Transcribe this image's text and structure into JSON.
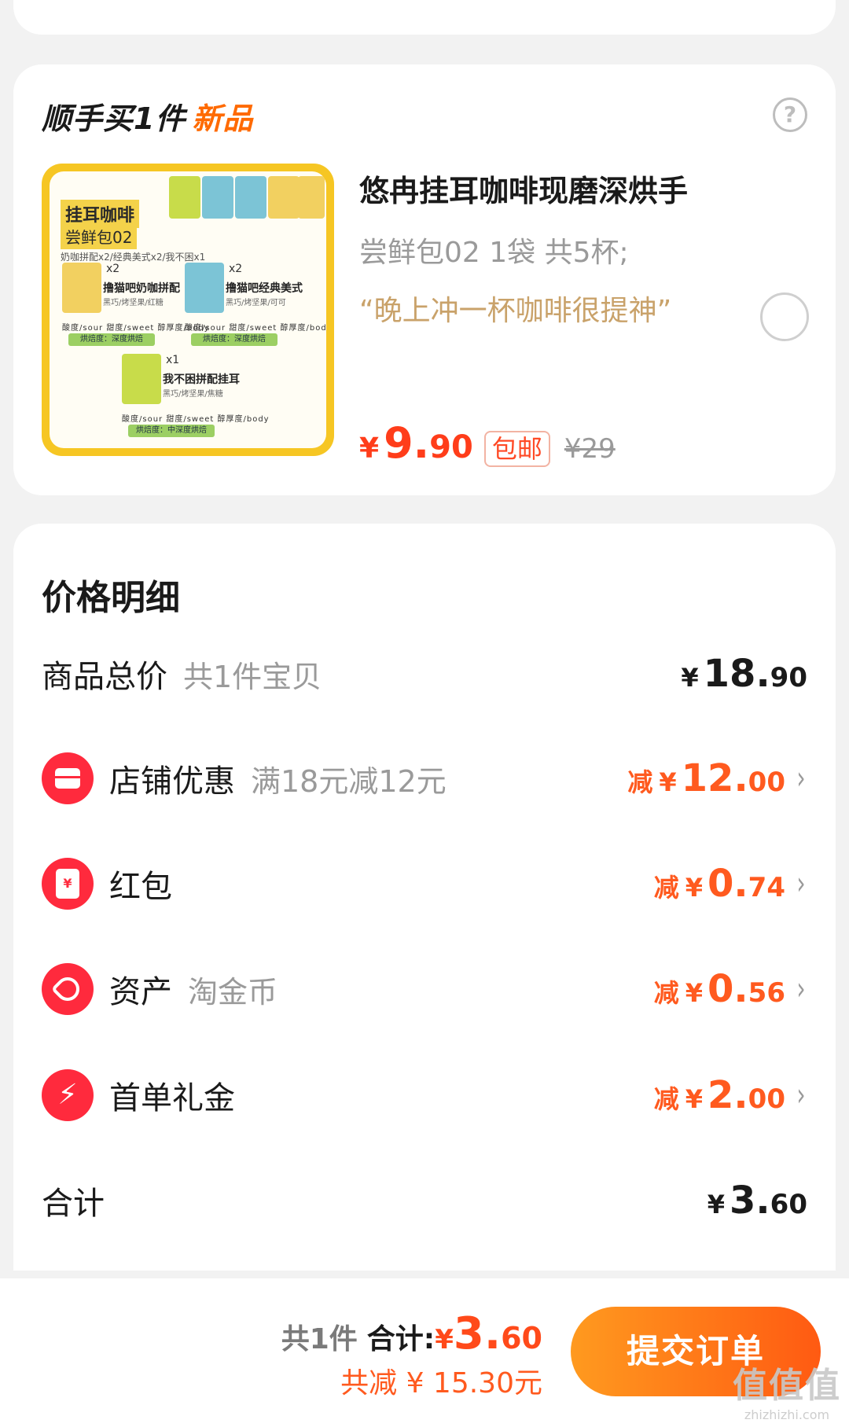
{
  "addon": {
    "title": "顺手买1件",
    "title_tag": "新品",
    "help": "?",
    "thumbnail": {
      "title": "挂耳咖啡",
      "subtitle": "尝鲜包02",
      "line": "奶咖拼配x2/经典美式x2/我不困x1",
      "packs": [
        {
          "qty": "x2",
          "name": "撸猫吧奶咖拼配",
          "notes": "黑巧/烤坚果/红糖",
          "dots": "酸度/sour 甜度/sweet 醇厚度/body",
          "roast": "烘焙度：深度烘焙"
        },
        {
          "qty": "x2",
          "name": "撸猫吧经典美式",
          "notes": "黑巧/烤坚果/可可",
          "dots": "酸度/sour 甜度/sweet 醇厚度/body",
          "roast": "烘焙度：深度烘焙"
        },
        {
          "qty": "x1",
          "name": "我不困拼配挂耳",
          "notes": "黑巧/烤坚果/焦糖",
          "dots": "酸度/sour 甜度/sweet 醇厚度/body",
          "roast": "烘焙度：中深度烘焙"
        }
      ]
    },
    "product_title": "悠冉挂耳咖啡现磨深烘手",
    "spec": "尝鲜包02 1袋 共5杯;",
    "quote": "“晚上冲一杯咖啡很提神”",
    "price_yen": "¥",
    "price_int": "9.",
    "price_dec": "90",
    "free_shipping": "包邮",
    "original_price": "¥29"
  },
  "price_detail": {
    "title": "价格明细",
    "rows": [
      {
        "label": "商品总价",
        "sub": "共1件宝贝",
        "cut": "",
        "yen": "¥",
        "int": "18.",
        "dec": "90"
      },
      {
        "label": "店铺优惠",
        "sub": "满18元减12元",
        "cut": "减",
        "yen": "¥",
        "int": "12.",
        "dec": "00",
        "icon": "store-icon"
      },
      {
        "label": "红包",
        "sub": "",
        "cut": "减",
        "yen": "¥",
        "int": "0.",
        "dec": "74",
        "icon": "red-envelope-icon",
        "icon_glyph": "¥"
      },
      {
        "label": "资产",
        "sub": "淘金币",
        "cut": "减",
        "yen": "¥",
        "int": "0.",
        "dec": "56",
        "icon": "tag-icon"
      },
      {
        "label": "首单礼金",
        "sub": "",
        "cut": "减",
        "yen": "¥",
        "int": "2.",
        "dec": "00",
        "icon": "lightning-icon",
        "icon_glyph": "⚡"
      },
      {
        "label": "合计",
        "sub": "",
        "cut": "",
        "yen": "¥",
        "int": "3.",
        "dec": "60"
      }
    ]
  },
  "bottom_bar": {
    "count": "共1件",
    "total_label": "合计:",
    "total_yen": "¥",
    "total_int": "3.",
    "total_dec": "60",
    "saved": "共减 ¥ 15.30元",
    "submit": "提交订单",
    "watermark": "值值值",
    "watermark_url": "zhizhizhi.com"
  },
  "colors": {
    "accent": "#ff5a1f",
    "price_red": "#ff3d1a",
    "icon_red": "#ff2a3d"
  }
}
